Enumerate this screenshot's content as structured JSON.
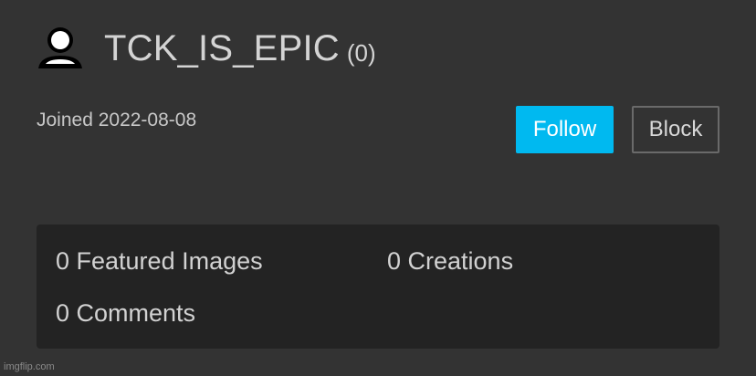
{
  "profile": {
    "avatar_icon": "user-icon",
    "username": "TCK_IS_EPIC",
    "points": "(0)",
    "joined": "Joined 2022-08-08"
  },
  "actions": {
    "follow_label": "Follow",
    "block_label": "Block",
    "follow_color": "#00b9f0"
  },
  "stats": {
    "featured_images": "0 Featured Images",
    "creations": "0 Creations",
    "comments": "0 Comments"
  },
  "watermark": "imgflip.com"
}
